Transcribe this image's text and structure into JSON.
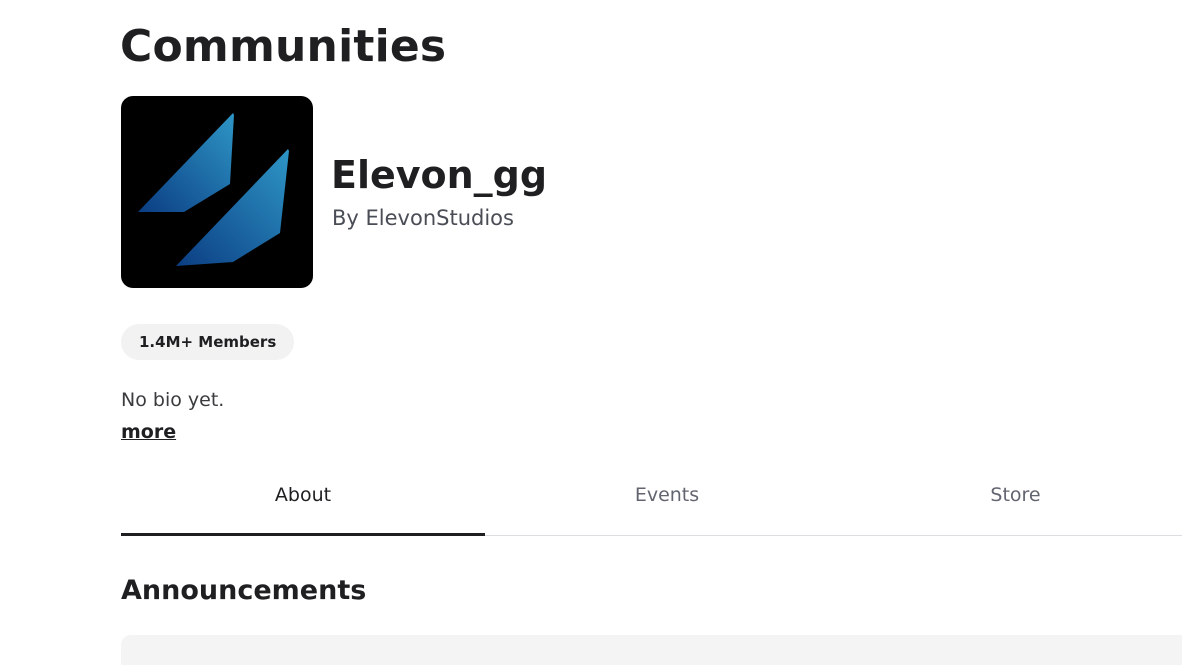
{
  "header": {
    "title": "Communities"
  },
  "group": {
    "name": "Elevon_gg",
    "owner_prefix": "By ",
    "owner_name": "ElevonStudios",
    "members_label": "1.4M+ Members",
    "bio": "No bio yet.",
    "more_label": "more",
    "logo_icon": "elevon-logo-icon"
  },
  "tabs": [
    {
      "label": "About",
      "active": true
    },
    {
      "label": "Events",
      "active": false
    },
    {
      "label": "Store",
      "active": false
    }
  ],
  "announcements": {
    "title": "Announcements"
  },
  "colors": {
    "logo_background": "#000000",
    "logo_gradient_light": "#2e96c6",
    "logo_gradient_dark": "#0b3d83",
    "pill_background": "#f2f2f3",
    "active_tab_indicator": "#1f1f22"
  }
}
